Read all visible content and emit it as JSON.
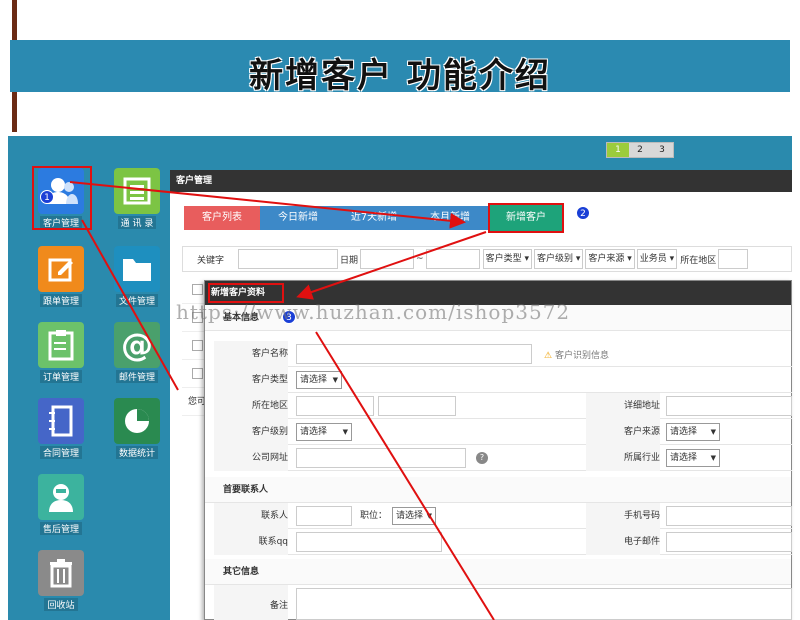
{
  "banner": {
    "title": "新增客户 功能介绍"
  },
  "pager": [
    "1",
    "2",
    "3"
  ],
  "sidebar": {
    "items": [
      {
        "label": "客户管理",
        "icon": "users-icon",
        "color": "#2c7be0"
      },
      {
        "label": "通 讯 录",
        "icon": "address-book-icon",
        "color": "#7cc444"
      },
      {
        "label": "跟单管理",
        "icon": "edit-icon",
        "color": "#f08a1c"
      },
      {
        "label": "文件管理",
        "icon": "folder-icon",
        "color": "#1e8fbf"
      },
      {
        "label": "订单管理",
        "icon": "clipboard-icon",
        "color": "#6cc26a"
      },
      {
        "label": "邮件管理",
        "icon": "at-icon",
        "color": "#4aa06c"
      },
      {
        "label": "合同管理",
        "icon": "notebook-icon",
        "color": "#4566c8"
      },
      {
        "label": "数据统计",
        "icon": "pie-chart-icon",
        "color": "#2a8a50"
      },
      {
        "label": "售后管理",
        "icon": "support-agent-icon",
        "color": "#3cb39e"
      },
      {
        "label": "回收站",
        "icon": "trash-icon",
        "color": "#8a8a8a"
      }
    ]
  },
  "main": {
    "title": "客户管理",
    "tabs": [
      "客户列表",
      "今日新增",
      "近7天新增",
      "本月新增",
      "新增客户"
    ],
    "filter": {
      "keyword_label": "关键字",
      "date_label": "日期",
      "date_sep": "~",
      "selects": [
        "客户类型",
        "客户级别",
        "客户来源",
        "业务员"
      ],
      "region_label": "所在地区"
    },
    "footer_text": "您可"
  },
  "modal": {
    "title": "新增客户资料",
    "sections": {
      "basic": "基本信息",
      "contact": "首要联系人",
      "other": "其它信息"
    },
    "fields": {
      "name": "客户名称",
      "name_hint": "客户识别信息",
      "type": "客户类型",
      "region": "所在地区",
      "address": "详细地址",
      "level": "客户级别",
      "source": "客户来源",
      "website": "公司网址",
      "industry": "所属行业",
      "contact_person": "联系人",
      "position": "职位：",
      "mobile": "手机号码",
      "qq": "联系qq",
      "email": "电子邮件",
      "remark": "备注"
    },
    "select_placeholder": "请选择"
  },
  "annotations": {
    "badges": [
      "1",
      "2",
      "3"
    ],
    "watermark": "https://www.huzhan.com/ishop3572"
  }
}
